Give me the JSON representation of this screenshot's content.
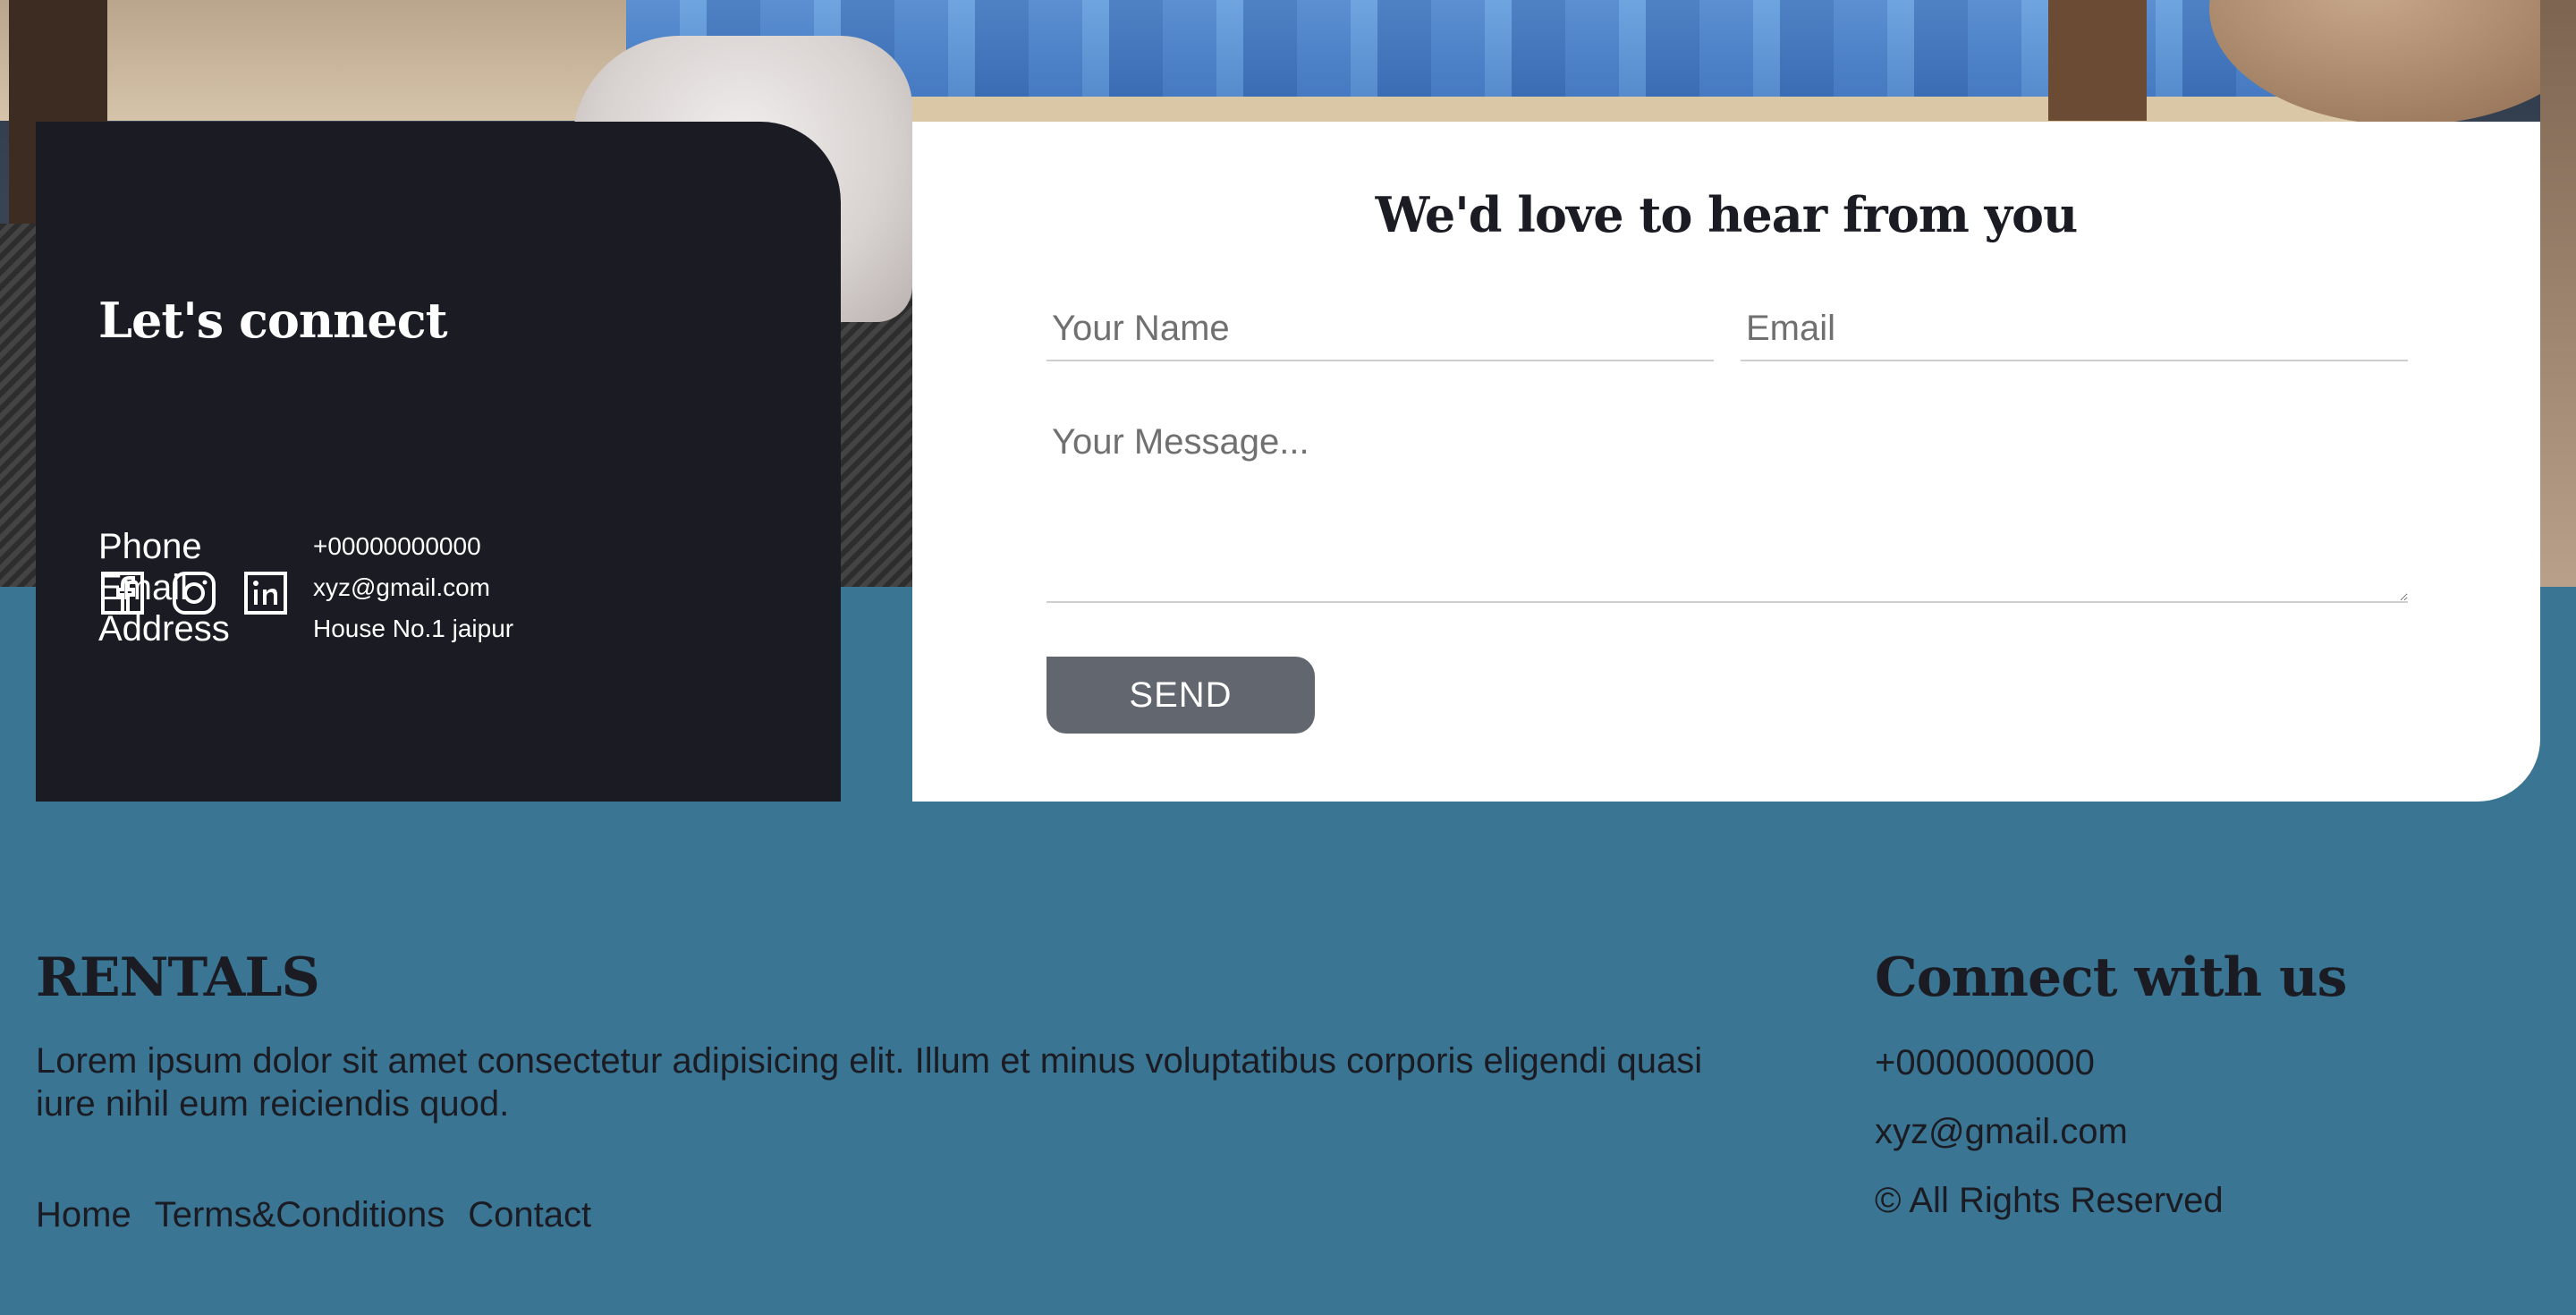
{
  "connect": {
    "title": "Let's connect",
    "phone_label": "Phone",
    "phone_value": "+00000000000",
    "email_label": "Email",
    "email_value": "xyz@gmail.com",
    "address_label": "Address",
    "address_value": "House No.1 jaipur",
    "socials": [
      "facebook-icon",
      "instagram-icon",
      "linkedin-icon"
    ]
  },
  "form": {
    "title": "We'd love to hear from you",
    "name_placeholder": "Your Name",
    "email_placeholder": "Email",
    "message_placeholder": "Your Message...",
    "send_label": "SEND"
  },
  "footer": {
    "brand": "RENTALS",
    "description": "Lorem ipsum dolor sit amet consectetur adipisicing elit. Illum et minus voluptatibus corporis eligendi quasi iure nihil eum reiciendis quod.",
    "nav": [
      "Home",
      "Terms&Conditions",
      "Contact"
    ],
    "connect_title": "Connect with us",
    "phone": "+0000000000",
    "email": "xyz@gmail.com",
    "rights": "© All Rights Reserved"
  },
  "colors": {
    "footer_bg": "#3a7593",
    "card_dark": "#1b1c23",
    "button": "#61666f"
  }
}
